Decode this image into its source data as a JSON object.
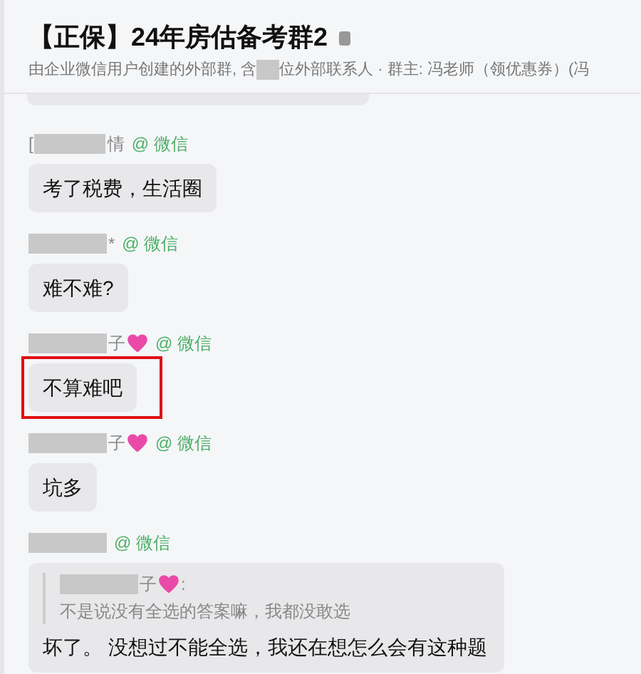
{
  "header": {
    "title": "【正保】24年房估备考群2",
    "subtitle_before": "由企业微信用户创建的外部群, 含",
    "subtitle_after": "位外部联系人 · 群主: 冯老师（领优惠券）(冯"
  },
  "messages": [
    {
      "name_before": "[",
      "name_after": "情",
      "heart": false,
      "source": "@ 微信",
      "text": "考了税费，生活圈",
      "highlighted": false
    },
    {
      "name_after": "*",
      "heart": false,
      "source": "@ 微信",
      "text": "难不难?",
      "highlighted": false
    },
    {
      "name_after": "子",
      "heart": true,
      "source": "@ 微信",
      "text": "不算难吧",
      "highlighted": true
    },
    {
      "name_after": "子",
      "heart": true,
      "source": "@ 微信",
      "text": "坑多",
      "highlighted": false
    },
    {
      "heart": false,
      "source": "@ 微信",
      "text": "坏了。 没想过不能全选，我还在想怎么会有这种题",
      "highlighted": false,
      "quote": {
        "name_after": "子",
        "heart": true,
        "colon": ":",
        "text": "不是说没有全选的答案嘛，我都没敢选"
      }
    }
  ]
}
